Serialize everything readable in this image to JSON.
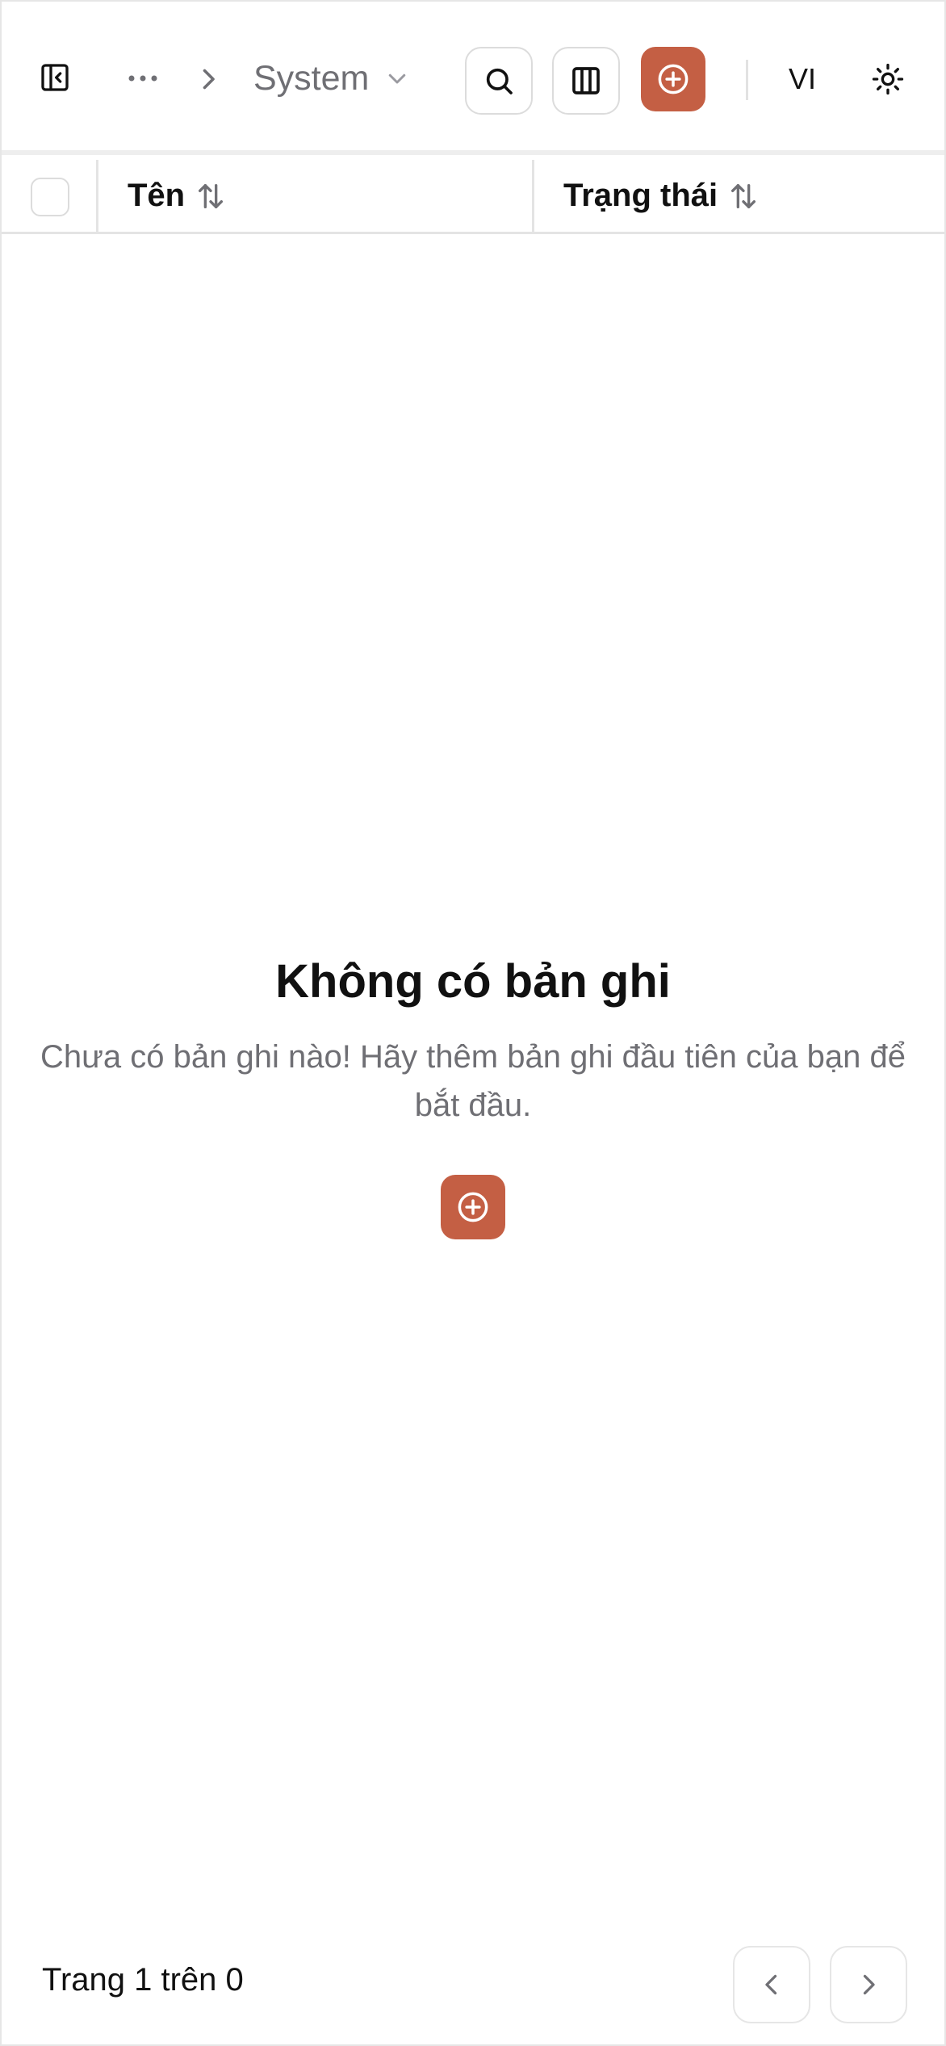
{
  "header": {
    "breadcrumb_current": "System",
    "language": "VI"
  },
  "table": {
    "columns": [
      {
        "label": "Tên"
      },
      {
        "label": "Trạng thái"
      }
    ]
  },
  "empty_state": {
    "title": "Không có bản ghi",
    "description": "Chưa có bản ghi nào! Hãy thêm bản ghi đầu tiên của bạn để bắt đầu."
  },
  "pagination": {
    "text": "Trang 1 trên 0"
  },
  "colors": {
    "accent": "#c45f44",
    "muted_text": "#6f6f74",
    "border": "#e4e4e4"
  },
  "icons": {
    "sidebar_toggle": "sidebar-collapse-icon",
    "more": "ellipsis-icon",
    "separator": "chevron-right-icon",
    "dropdown": "chevron-down-icon",
    "search": "search-icon",
    "columns": "columns-icon",
    "add": "plus-circle-icon",
    "theme": "sun-icon",
    "sort": "sort-arrows-icon",
    "prev": "chevron-left-icon",
    "next": "chevron-right-icon"
  }
}
